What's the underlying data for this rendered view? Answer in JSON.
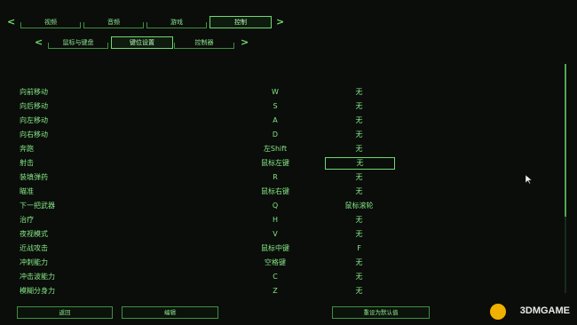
{
  "top_tabs": [
    "视频",
    "音频",
    "游戏",
    "控制"
  ],
  "active_top_tab": 3,
  "sub_tabs": [
    "鼠标与键盘",
    "键位设置",
    "控制器"
  ],
  "active_sub_tab": 1,
  "keybinds": [
    {
      "action": "向前移动",
      "primary": "W",
      "secondary": "无"
    },
    {
      "action": "向后移动",
      "primary": "S",
      "secondary": "无"
    },
    {
      "action": "向左移动",
      "primary": "A",
      "secondary": "无"
    },
    {
      "action": "向右移动",
      "primary": "D",
      "secondary": "无"
    },
    {
      "action": "奔跑",
      "primary": "左Shift",
      "secondary": "无"
    },
    {
      "action": "射击",
      "primary": "鼠标左键",
      "secondary": "无"
    },
    {
      "action": "装填弹药",
      "primary": "R",
      "secondary": "无"
    },
    {
      "action": "瞄准",
      "primary": "鼠标右键",
      "secondary": "无"
    },
    {
      "action": "下一把武器",
      "primary": "Q",
      "secondary": "鼠标滚轮"
    },
    {
      "action": "治疗",
      "primary": "H",
      "secondary": "无"
    },
    {
      "action": "夜视模式",
      "primary": "V",
      "secondary": "无"
    },
    {
      "action": "近战攻击",
      "primary": "鼠标中键",
      "secondary": "F"
    },
    {
      "action": "冲刺能力",
      "primary": "空格键",
      "secondary": "无"
    },
    {
      "action": "冲击波能力",
      "primary": "C",
      "secondary": "无"
    },
    {
      "action": "模糊分身力",
      "primary": "Z",
      "secondary": "无"
    }
  ],
  "selected_row": 5,
  "buttons": {
    "back": "返回",
    "edit": "编辑",
    "reset": "重设为默认值"
  },
  "watermark": "3DMGAME",
  "colors": {
    "accent": "#6fd86f",
    "background": "#0a0d0a"
  }
}
